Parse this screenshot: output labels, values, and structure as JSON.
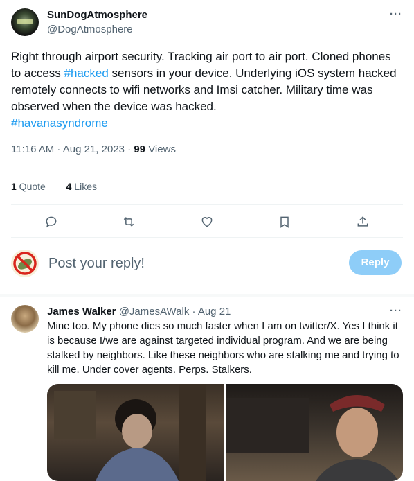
{
  "tweet": {
    "author_name": "SunDogAtmosphere",
    "author_handle": "@DogAtmosphere",
    "text_parts": {
      "p1": "Right through airport security. Tracking air port to air port. Cloned phones to access ",
      "hashtag1": "#hacked",
      "p2": " sensors in your device. Underlying iOS system hacked remotely connects to wifi networks and Imsi catcher. Military time was observed when the device was hacked.",
      "hashtag2": "#havanasyndrome"
    },
    "time": "11:16 AM · Aug 21, 2023 · ",
    "views_count": "99",
    "views_label": " Views",
    "quotes_count": "1",
    "quotes_label": " Quote",
    "likes_count": "4",
    "likes_label": " Likes",
    "more": "···"
  },
  "composer": {
    "placeholder": "Post your reply!",
    "button_label": "Reply"
  },
  "reply": {
    "author_name": "James Walker",
    "author_handle": "@JamesAWalk",
    "date": " · Aug 21",
    "text": "Mine too. My phone dies so much faster when I am on twitter/X. Yes I think it is because I/we are against targeted individual program. And we are being stalked by neighbors. Like these neighbors who are stalking me and trying to kill me. Under cover agents. Perps. Stalkers.",
    "more": "···"
  },
  "colors": {
    "accent": "#1d9bf0",
    "reply_button_disabled": "#8ecdf8",
    "secondary_text": "#536471"
  },
  "icons": [
    "reply-icon",
    "retweet-icon",
    "like-icon",
    "bookmark-icon",
    "share-icon",
    "no-symbol-icon"
  ]
}
